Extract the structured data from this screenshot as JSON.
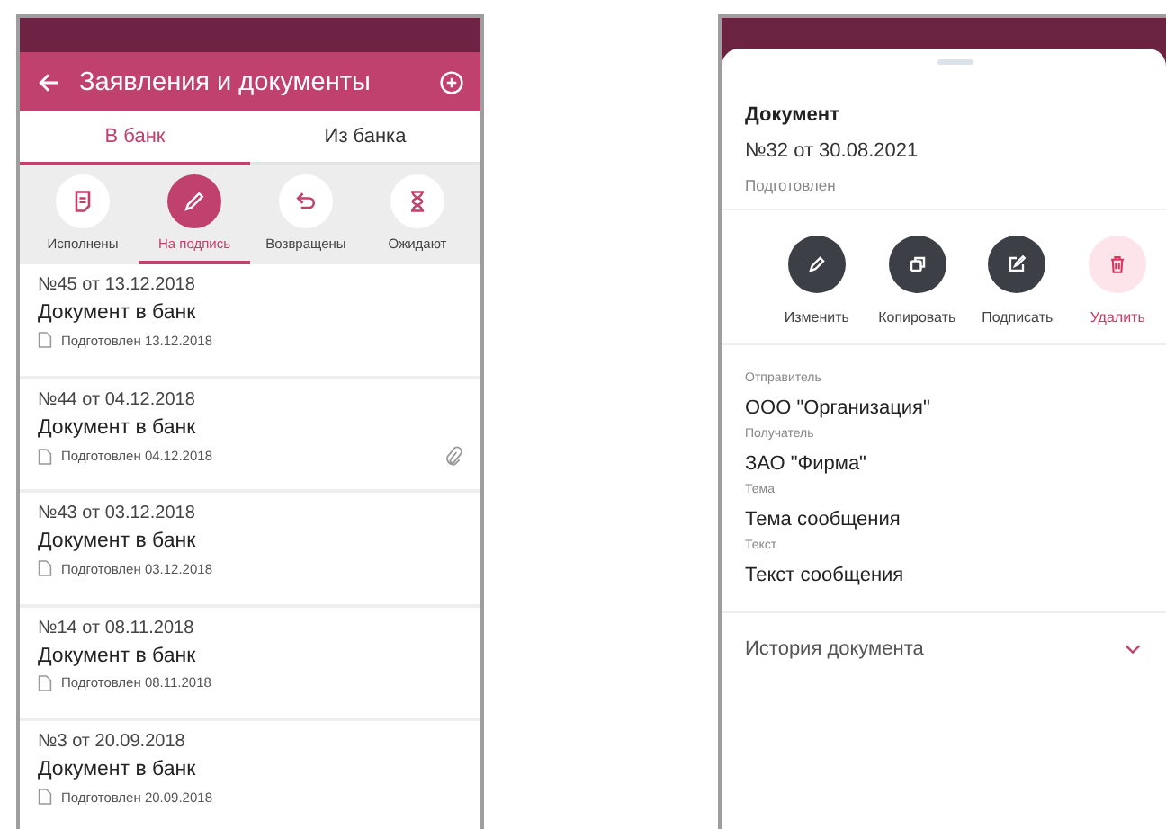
{
  "left_screen": {
    "header": {
      "title": "Заявления и документы"
    },
    "tabs": [
      {
        "label": "В банк",
        "selected": true
      },
      {
        "label": "Из банка",
        "selected": false
      }
    ],
    "filters": [
      {
        "label": "Исполнены",
        "kind": "done",
        "selected": false
      },
      {
        "label": "На подпись",
        "kind": "sign",
        "selected": true
      },
      {
        "label": "Возвращены",
        "kind": "returned",
        "selected": false
      },
      {
        "label": "Ожидают",
        "kind": "waiting",
        "selected": false
      }
    ],
    "documents": [
      {
        "number": "№45 от 13.12.2018",
        "title": "Документ в банк",
        "status": "Подготовлен 13.12.2018",
        "attachment": false
      },
      {
        "number": "№44 от 04.12.2018",
        "title": "Документ в банк",
        "status": "Подготовлен 04.12.2018",
        "attachment": true
      },
      {
        "number": "№43 от 03.12.2018",
        "title": "Документ в банк",
        "status": "Подготовлен 03.12.2018",
        "attachment": false
      },
      {
        "number": "№14 от 08.11.2018",
        "title": "Документ в банк",
        "status": "Подготовлен 08.11.2018",
        "attachment": false
      },
      {
        "number": "№3 от 20.09.2018",
        "title": "Документ в банк",
        "status": "Подготовлен 20.09.2018",
        "attachment": false
      }
    ]
  },
  "right_screen": {
    "heading": "Документ",
    "number": "№32 от 30.08.2021",
    "status": "Подготовлен",
    "actions": [
      {
        "label": "Изменить",
        "kind": "edit"
      },
      {
        "label": "Копировать",
        "kind": "copy"
      },
      {
        "label": "Подписать",
        "kind": "sign"
      },
      {
        "label": "Удалить",
        "kind": "delete"
      }
    ],
    "fields": [
      {
        "label": "Отправитель",
        "value": "ООО \"Организация\""
      },
      {
        "label": "Получатель",
        "value": "ЗАО \"Фирма\""
      },
      {
        "label": "Тема",
        "value": "Тема сообщения"
      },
      {
        "label": "Текст",
        "value": "Текст сообщения"
      }
    ],
    "history": {
      "label": "История документа",
      "expanded": false
    }
  }
}
